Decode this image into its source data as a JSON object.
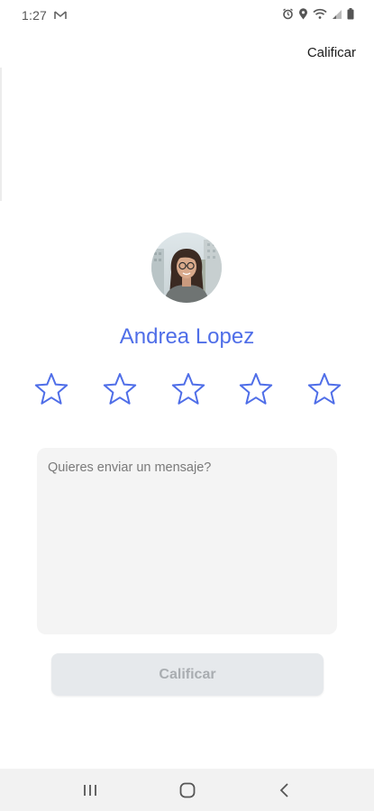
{
  "status_bar": {
    "time": "1:27",
    "left_icons": [
      "mail-icon"
    ],
    "right_icons": [
      "alarm-icon",
      "location-icon",
      "wifi-icon",
      "signal-icon",
      "battery-icon"
    ]
  },
  "header": {
    "action_label": "Calificar"
  },
  "profile": {
    "name": "Andrea Lopez",
    "avatar_icon": "profile-photo"
  },
  "rating": {
    "max_stars": 5,
    "value": 0,
    "star_icon": "star-outline-icon"
  },
  "message": {
    "placeholder": "Quieres enviar un mensaje?",
    "value": ""
  },
  "submit": {
    "label": "Calificar"
  },
  "nav_bar": {
    "icons": [
      "recents-icon",
      "home-icon",
      "back-icon"
    ]
  },
  "colors": {
    "accent": "#4f6ee8",
    "input_bg": "#f4f4f4",
    "button_disabled_bg": "#e6e9ec",
    "button_disabled_text": "#a9adb1",
    "nav_bg": "#f2f2f2"
  }
}
